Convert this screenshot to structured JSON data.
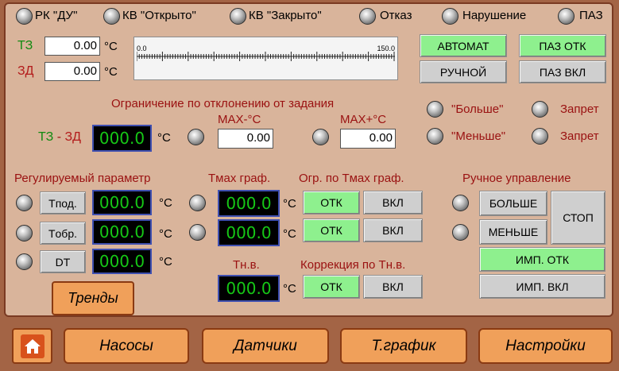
{
  "status_row": {
    "rk_du": "РК \"ДУ\"",
    "kv_open": "КВ \"Открыто\"",
    "kv_closed": "КВ \"Закрыто\"",
    "fault": "Отказ",
    "violation": "Нарушение",
    "paz": "ПАЗ"
  },
  "setpoints": {
    "tz_label": "ТЗ",
    "tz_value": "0.00",
    "zd_label": "ЗД",
    "zd_value": "0.00",
    "unit": "°C",
    "scale_min": "0.0",
    "scale_max": "150.0"
  },
  "mode": {
    "auto": "АВТОМАТ",
    "manual": "РУЧНОЙ",
    "paz_off": "ПАЗ ОТК",
    "paz_on": "ПАЗ ВКЛ"
  },
  "deviation": {
    "title": "Ограничение по отклонению от задания",
    "tz_zd_label": "ТЗ - ЗД",
    "tz_zd_value": "000.0",
    "max_minus_label": "MAX-°C",
    "max_minus_value": "0.00",
    "max_plus_label": "MAX+°C",
    "max_plus_value": "0.00"
  },
  "limits": {
    "more": "\"Больше\"",
    "less": "\"Меньше\"",
    "forbid1": "Запрет",
    "forbid2": "Запрет"
  },
  "regulated": {
    "title": "Регулируемый параметр",
    "rows": [
      {
        "button": "Tпод.",
        "value": "000.0"
      },
      {
        "button": "Tобр.",
        "value": "000.0"
      },
      {
        "button": "DT",
        "value": "000.0"
      }
    ],
    "trends": "Тренды"
  },
  "tmax": {
    "title": "Tмах граф.",
    "values": [
      "000.0",
      "000.0"
    ]
  },
  "tmax_limit": {
    "title": "Огр. по Tмах граф.",
    "off": "ОТК",
    "on": "ВКЛ"
  },
  "tnv": {
    "title": "Тн.в.",
    "value": "000.0"
  },
  "correction": {
    "title": "Коррекция по Тн.в.",
    "off": "ОТК",
    "on": "ВКЛ"
  },
  "manual_control": {
    "title": "Ручное управление",
    "more": "БОЛЬШЕ",
    "less": "МЕНЬШЕ",
    "stop": "СТОП",
    "imp_off": "ИМП. ОТК",
    "imp_on": "ИМП. ВКЛ"
  },
  "nav": {
    "home_icon": "home-icon",
    "pumps": "Насосы",
    "sensors": "Датчики",
    "graph": "Т.график",
    "settings": "Настройки"
  },
  "colors": {
    "background": "#a36445",
    "panel": "#d9b49b",
    "lcd_text": "#16c816",
    "active_button": "#8ef08e",
    "nav_button": "#f0a05a"
  }
}
